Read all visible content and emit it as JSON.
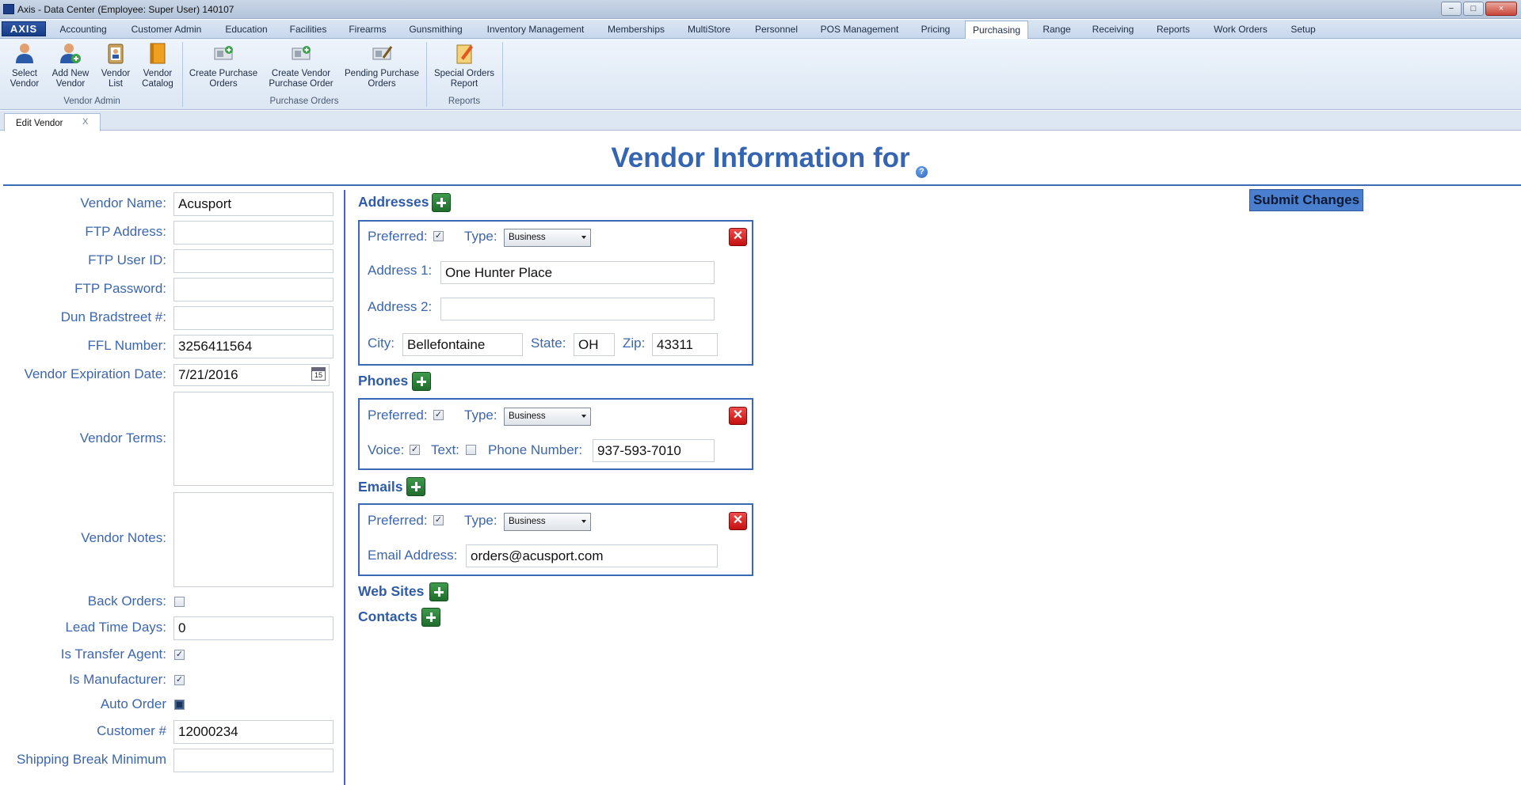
{
  "window": {
    "title": "Axis - Data Center  (Employee: Super User) 140107",
    "min": "−",
    "max": "□",
    "close": "×"
  },
  "menu": {
    "logo": "AXIS",
    "tabs": [
      "Accounting",
      "Customer Admin",
      "Education",
      "Facilities",
      "Firearms",
      "Gunsmithing",
      "Inventory Management",
      "Memberships",
      "MultiStore",
      "Personnel",
      "POS Management",
      "Pricing",
      "Purchasing",
      "Range",
      "Receiving",
      "Reports",
      "Work Orders",
      "Setup"
    ],
    "active": "Purchasing"
  },
  "ribbon": {
    "vendor_admin": {
      "label": "Vendor Admin",
      "select_vendor": [
        "Select",
        "Vendor"
      ],
      "add_new_vendor": [
        "Add New",
        "Vendor"
      ],
      "vendor_list": [
        "Vendor",
        "List"
      ],
      "vendor_catalog": [
        "Vendor",
        "Catalog"
      ]
    },
    "purchase_orders": {
      "label": "Purchase Orders",
      "create_po": [
        "Create Purchase",
        "Orders"
      ],
      "create_vendor_po": [
        "Create Vendor",
        "Purchase Order"
      ],
      "pending_po": [
        "Pending Purchase",
        "Orders"
      ]
    },
    "reports": {
      "label": "Reports",
      "special_orders": [
        "Special Orders",
        "Report"
      ]
    }
  },
  "doc_tab": {
    "label": "Edit Vendor",
    "close": "X"
  },
  "page": {
    "title": "Vendor Information for",
    "help": "?",
    "submit": "Submit Changes"
  },
  "form": {
    "vendor_name": {
      "label": "Vendor Name:",
      "value": "Acusport"
    },
    "ftp_address": {
      "label": "FTP Address:",
      "value": ""
    },
    "ftp_user_id": {
      "label": "FTP User ID:",
      "value": ""
    },
    "ftp_password": {
      "label": "FTP Password:",
      "value": ""
    },
    "dun_bradstreet": {
      "label": "Dun Bradstreet #:",
      "value": ""
    },
    "ffl_number": {
      "label": "FFL Number:",
      "value": "3256411564"
    },
    "expiration_date": {
      "label": "Vendor Expiration Date:",
      "value": "7/21/2016",
      "calendar_day": "15"
    },
    "vendor_terms": {
      "label": "Vendor Terms:",
      "value": ""
    },
    "vendor_notes": {
      "label": "Vendor Notes:",
      "value": ""
    },
    "back_orders": {
      "label": "Back Orders:",
      "checked": false
    },
    "lead_time_days": {
      "label": "Lead Time Days:",
      "value": "0"
    },
    "is_transfer_agent": {
      "label": "Is Transfer Agent:",
      "checked": true
    },
    "is_manufacturer": {
      "label": "Is Manufacturer:",
      "checked": true
    },
    "auto_order": {
      "label": "Auto Order",
      "checked": "indeterminate"
    },
    "customer_number": {
      "label": "Customer #",
      "value": "12000234"
    },
    "shipping_break_min": {
      "label": "Shipping Break Minimum",
      "value": ""
    }
  },
  "addresses": {
    "heading": "Addresses",
    "preferred_label": "Preferred:",
    "preferred": true,
    "type_label": "Type:",
    "type": "Business",
    "address1_label": "Address 1:",
    "address1": "One Hunter Place",
    "address2_label": "Address 2:",
    "address2": "",
    "city_label": "City:",
    "city": "Bellefontaine",
    "state_label": "State:",
    "state": "OH",
    "zip_label": "Zip:",
    "zip": "43311"
  },
  "phones": {
    "heading": "Phones",
    "preferred_label": "Preferred:",
    "preferred": true,
    "type_label": "Type:",
    "type": "Business",
    "voice_label": "Voice:",
    "voice": true,
    "text_label": "Text:",
    "text": false,
    "number_label": "Phone Number:",
    "number": "937-593-7010"
  },
  "emails": {
    "heading": "Emails",
    "preferred_label": "Preferred:",
    "preferred": true,
    "type_label": "Type:",
    "type": "Business",
    "address_label": "Email Address:",
    "address": "orders@acusport.com"
  },
  "web_sites": {
    "heading": "Web Sites"
  },
  "contacts": {
    "heading": "Contacts"
  },
  "colors": {
    "accent": "#3565b0",
    "label": "#3c66ad",
    "add": "#2a7f38",
    "delete": "#d61a1a"
  }
}
